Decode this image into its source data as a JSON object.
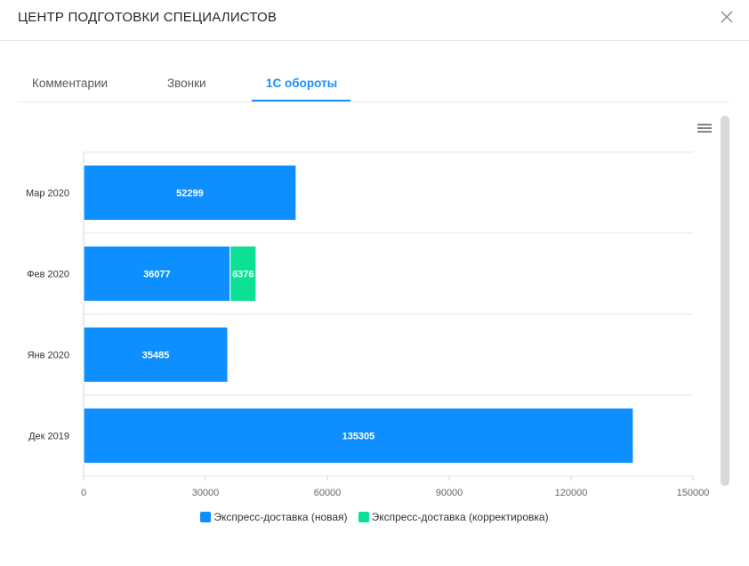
{
  "modal": {
    "title": "ЦЕНТР ПОДГОТОВКИ СПЕЦИАЛИСТОВ"
  },
  "tabs": [
    {
      "label": "Комментарии",
      "active": false
    },
    {
      "label": "Звонки",
      "active": false
    },
    {
      "label": "1С обороты",
      "active": true
    }
  ],
  "colors": {
    "accent": "#1890ff",
    "series_new": "#0d8fff",
    "series_corr": "#0be094"
  },
  "icons": {
    "close": "close-icon",
    "menu": "hamburger-menu-icon"
  },
  "chart_data": {
    "type": "bar",
    "orientation": "horizontal",
    "stacked": true,
    "categories": [
      "Мар 2020",
      "Фев 2020",
      "Янв 2020",
      "Дек 2019"
    ],
    "series": [
      {
        "name": "Экспресс-доставка (новая)",
        "color": "#0d8fff",
        "values": [
          52299,
          36077,
          35485,
          135305
        ]
      },
      {
        "name": "Экспресс-доставка (корректировка)",
        "color": "#0be094",
        "values": [
          0,
          6376,
          0,
          0
        ]
      }
    ],
    "xlim": [
      0,
      150000
    ],
    "xticks": [
      "0",
      "30000",
      "60000",
      "90000",
      "120000",
      "150000"
    ],
    "title": "",
    "xlabel": "",
    "ylabel": "",
    "grid": true,
    "legend": "bottom-center"
  }
}
